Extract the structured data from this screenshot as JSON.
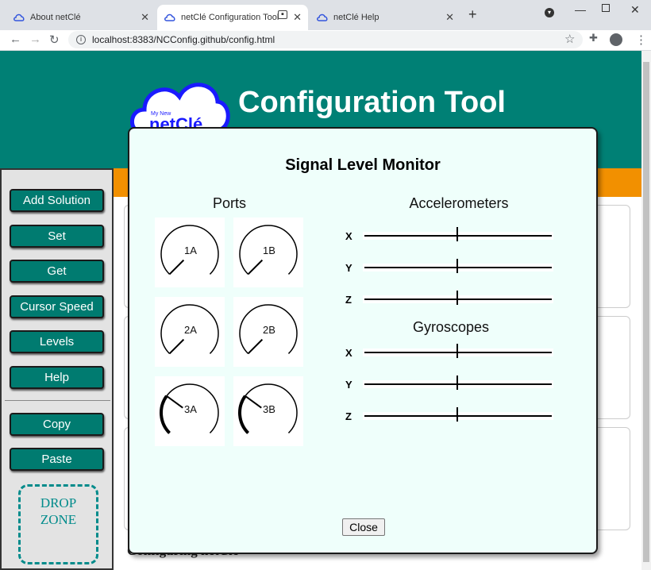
{
  "browser": {
    "tabs": [
      {
        "label": "About netClé",
        "active": false
      },
      {
        "label": "netClé Configuration Tool",
        "active": true
      },
      {
        "label": "netClé Help",
        "active": false
      }
    ],
    "url": "localhost:8383/NCConfig.github/config.html"
  },
  "header": {
    "logo_text_top": "My New",
    "logo_text_main": "netClé",
    "title": "Configuration Tool"
  },
  "sidebar": {
    "buttons": [
      "Add Solution",
      "Set",
      "Get",
      "Cursor Speed",
      "Levels",
      "Help"
    ],
    "clipboard_buttons": [
      "Copy",
      "Paste"
    ],
    "drop_zone": [
      "DROP",
      "ZONE"
    ]
  },
  "background": {
    "partial_heading": "Configuring netClé"
  },
  "modal": {
    "title": "Signal Level Monitor",
    "ports_title": "Ports",
    "ports": [
      {
        "label": "1A",
        "level": 0
      },
      {
        "label": "1B",
        "level": 0
      },
      {
        "label": "2A",
        "level": 0
      },
      {
        "label": "2B",
        "level": 0
      },
      {
        "label": "3A",
        "level": 0.3
      },
      {
        "label": "3B",
        "level": 0.3
      }
    ],
    "accelerometers_title": "Accelerometers",
    "accelerometers": [
      {
        "axis": "X",
        "value": 0
      },
      {
        "axis": "Y",
        "value": 0
      },
      {
        "axis": "Z",
        "value": 0
      }
    ],
    "gyroscopes_title": "Gyroscopes",
    "gyroscopes": [
      {
        "axis": "X",
        "value": 0
      },
      {
        "axis": "Y",
        "value": 0
      },
      {
        "axis": "Z",
        "value": 0
      }
    ],
    "close_label": "Close"
  }
}
